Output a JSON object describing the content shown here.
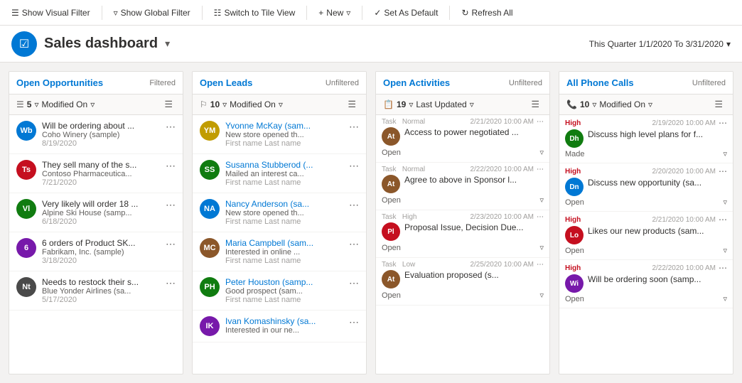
{
  "toolbar": {
    "show_visual_filter": "Show Visual Filter",
    "show_global_filter": "Show Global Filter",
    "switch_to_tile": "Switch to Tile View",
    "new": "New",
    "set_as_default": "Set As Default",
    "refresh_all": "Refresh All"
  },
  "header": {
    "title": "Sales dashboard",
    "date_range": "This Quarter 1/1/2020 To 3/31/2020"
  },
  "panels": {
    "opportunities": {
      "title": "Open Opportunities",
      "filter_state": "Filtered",
      "count": 5,
      "sort_by": "Modified On",
      "items": [
        {
          "initials": "Wb",
          "color": "#0078d4",
          "title": "Will be ordering about ...",
          "subtitle": "Coho Winery (sample)",
          "date": "8/19/2020"
        },
        {
          "initials": "Ts",
          "color": "#c50f1f",
          "title": "They sell many of the s...",
          "subtitle": "Contoso Pharmaceutica...",
          "date": "7/21/2020"
        },
        {
          "initials": "Vl",
          "color": "#107c10",
          "title": "Very likely will order 18 ...",
          "subtitle": "Alpine Ski House (samp...",
          "date": "6/18/2020"
        },
        {
          "initials": "6",
          "color": "#7719aa",
          "title": "6 orders of Product SK...",
          "subtitle": "Fabrikam, Inc. (sample)",
          "date": "3/18/2020"
        },
        {
          "initials": "Nt",
          "color": "#4a4a4a",
          "title": "Needs to restock their s...",
          "subtitle": "Blue Yonder Airlines (sa...",
          "date": "5/17/2020"
        }
      ]
    },
    "leads": {
      "title": "Open Leads",
      "filter_state": "Unfiltered",
      "count": 10,
      "sort_by": "Modified On",
      "items": [
        {
          "initials": "YM",
          "color": "#c19c00",
          "name": "Yvonne McKay (sam...",
          "desc": "New store opened th...",
          "sub": "First name Last name"
        },
        {
          "initials": "SS",
          "color": "#107c10",
          "name": "Susanna Stubberod (...",
          "desc": "Mailed an interest ca...",
          "sub": "First name Last name"
        },
        {
          "initials": "NA",
          "color": "#0078d4",
          "name": "Nancy Anderson (sa...",
          "desc": "New store opened th...",
          "sub": "First name Last name"
        },
        {
          "initials": "MC",
          "color": "#8b572a",
          "name": "Maria Campbell (sam...",
          "desc": "Interested in online ...",
          "sub": "First name Last name"
        },
        {
          "initials": "PH",
          "color": "#107c10",
          "name": "Peter Houston (samp...",
          "desc": "Good prospect (sam...",
          "sub": "First name Last name"
        },
        {
          "initials": "IK",
          "color": "#7719aa",
          "name": "Ivan Komashinsky (sa...",
          "desc": "Interested in our ne...",
          "sub": ""
        }
      ]
    },
    "activities": {
      "title": "Open Activities",
      "filter_state": "Unfiltered",
      "count": 19,
      "sort_by": "Last Updated",
      "items": [
        {
          "type": "Task",
          "priority": "Normal",
          "datetime": "2/21/2020 10:00 AM",
          "initials": "At",
          "color": "#8b572a",
          "title": "Access to power negotiated ...",
          "status": "Open"
        },
        {
          "type": "Task",
          "priority": "Normal",
          "datetime": "2/22/2020 10:00 AM",
          "initials": "At",
          "color": "#8b572a",
          "title": "Agree to above in Sponsor l...",
          "status": "Open"
        },
        {
          "type": "Task",
          "priority": "High",
          "datetime": "2/23/2020 10:00 AM",
          "initials": "Pl",
          "color": "#c50f1f",
          "title": "Proposal Issue, Decision Due...",
          "status": "Open"
        },
        {
          "type": "Task",
          "priority": "Low",
          "datetime": "2/25/2020 10:00 AM",
          "initials": "At",
          "color": "#8b572a",
          "title": "Evaluation proposed (s...",
          "status": "Open"
        }
      ]
    },
    "phone_calls": {
      "title": "All Phone Calls",
      "filter_state": "Unfiltered",
      "count": 10,
      "sort_by": "Modified On",
      "items": [
        {
          "priority": "High",
          "datetime": "2/19/2020 10:00 AM",
          "initials": "Dh",
          "color": "#107c10",
          "title": "Discuss high level plans for f...",
          "status": "Made"
        },
        {
          "priority": "High",
          "datetime": "2/20/2020 10:00 AM",
          "initials": "Dn",
          "color": "#0078d4",
          "title": "Discuss new opportunity (sa...",
          "status": "Open"
        },
        {
          "priority": "High",
          "datetime": "2/21/2020 10:00 AM",
          "initials": "Lo",
          "color": "#c50f1f",
          "title": "Likes our new products (sam...",
          "status": "Open"
        },
        {
          "priority": "High",
          "datetime": "2/22/2020 10:00 AM",
          "initials": "Wi",
          "color": "#7719aa",
          "title": "Will be ordering soon (samp...",
          "status": "Open"
        }
      ]
    }
  }
}
